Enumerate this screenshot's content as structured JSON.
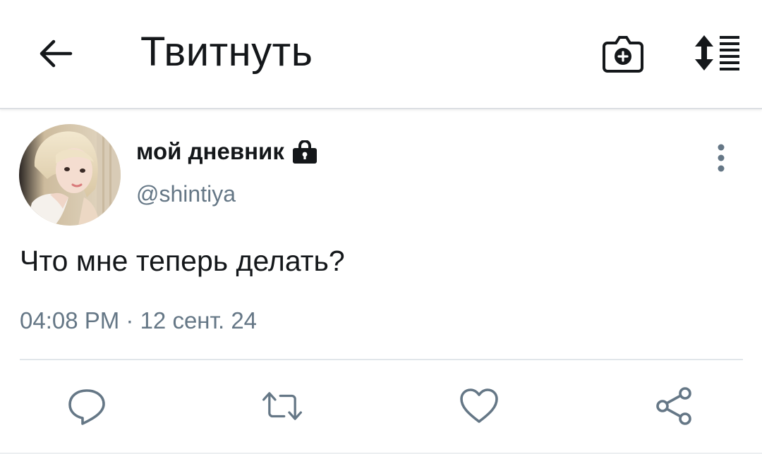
{
  "header": {
    "title": "Твитнуть",
    "back_icon": "arrow-left-icon",
    "camera_icon": "camera-add-icon",
    "sort_icon": "sort-list-icon"
  },
  "tweet": {
    "display_name": "мой дневник",
    "protected_icon": "lock-icon",
    "handle": "@shintiya",
    "text": "Что мне теперь делать?",
    "timestamp": "04:08 PM · 12 сент. 24",
    "more_icon": "more-vertical-icon"
  },
  "actions": {
    "reply_icon": "reply-icon",
    "retweet_icon": "retweet-icon",
    "like_icon": "heart-icon",
    "share_icon": "share-icon"
  },
  "colors": {
    "text_primary": "#14171a",
    "text_secondary": "#657786",
    "icon_gray": "#657786",
    "divider": "#e1e6ea"
  }
}
